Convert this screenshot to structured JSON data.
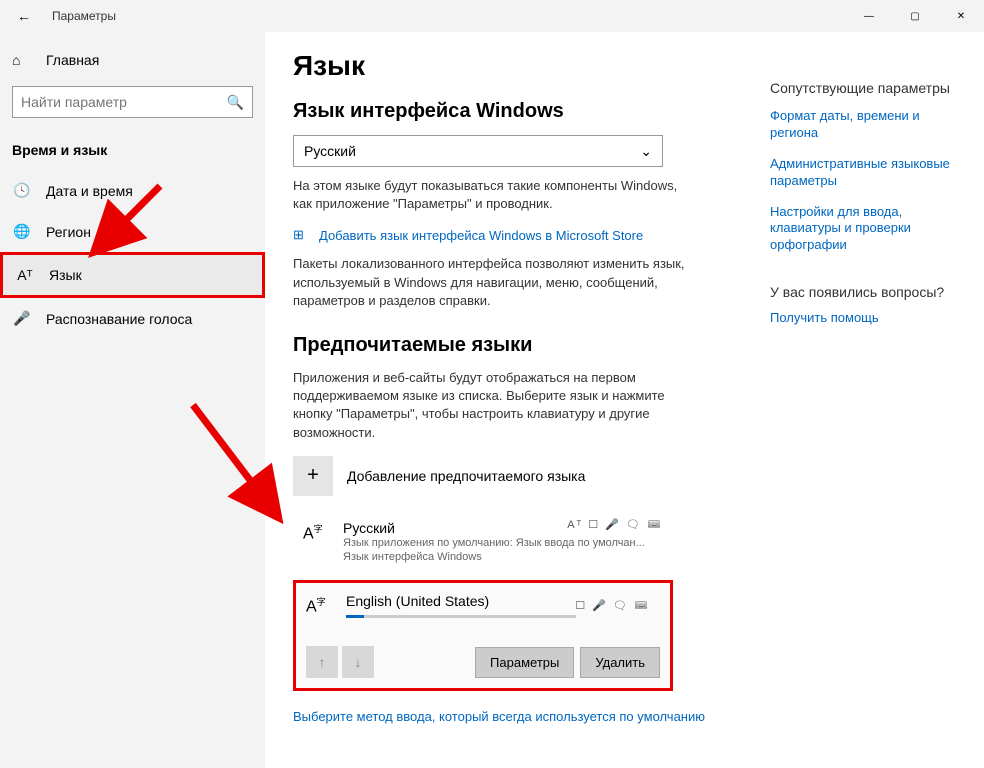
{
  "titlebar": {
    "title": "Параметры"
  },
  "sidebar": {
    "home": "Главная",
    "search_placeholder": "Найти параметр",
    "group_header": "Время и язык",
    "items": [
      {
        "label": "Дата и время",
        "icon": "🕓"
      },
      {
        "label": "Регион",
        "icon": "🌐"
      },
      {
        "label": "Язык",
        "icon": "Aᵀ",
        "selected": true
      },
      {
        "label": "Распознавание голоса",
        "icon": "🎤"
      }
    ]
  },
  "main": {
    "page_title": "Язык",
    "section1": {
      "heading": "Язык интерфейса Windows",
      "dropdown_value": "Русский",
      "desc": "На этом языке будут показываться такие компоненты Windows, как приложение \"Параметры\" и проводник.",
      "store_link": "Добавить язык интерфейса Windows в Microsoft Store",
      "packs_desc": "Пакеты локализованного интерфейса позволяют изменить язык, используемый в Windows для навигации, меню, сообщений, параметров и разделов справки."
    },
    "section2": {
      "heading": "Предпочитаемые языки",
      "desc": "Приложения и веб-сайты будут отображаться на первом поддерживаемом языке из списка. Выберите язык и нажмите кнопку \"Параметры\", чтобы настроить клавиатуру и другие возможности.",
      "add_label": "Добавление предпочитаемого языка",
      "languages": [
        {
          "name": "Русский",
          "meta1": "Язык приложения по умолчанию: Язык ввода по умолчан...",
          "meta2": "Язык интерфейса Windows",
          "icons": "Aᵀ ☐ 🎤 🗨 ⌨"
        },
        {
          "name": "English (United States)",
          "icons": "☐ 🎤 🗨 ⌨",
          "expanded": true,
          "btn_params": "Параметры",
          "btn_delete": "Удалить"
        }
      ],
      "default_link": "Выберите метод ввода, который всегда используется по умолчанию"
    }
  },
  "rightpane": {
    "heading": "Сопутствующие параметры",
    "links": [
      "Формат даты, времени и региона",
      "Административные языковые параметры",
      "Настройки для ввода, клавиатуры и проверки орфографии"
    ],
    "q_heading": "У вас появились вопросы?",
    "help_link": "Получить помощь"
  }
}
